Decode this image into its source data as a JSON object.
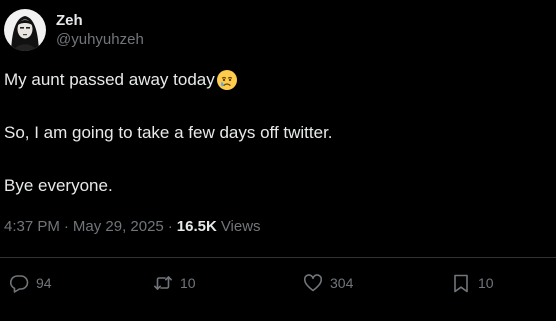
{
  "colors": {
    "background": "#000000",
    "text_primary": "#e7e9ea",
    "text_secondary": "#71767b",
    "divider": "#2f3336"
  },
  "author": {
    "display_name": "Zeh",
    "handle": "@yuhyuhzeh",
    "avatar_icon": "avatar-photo"
  },
  "tweet": {
    "lines": [
      "My aunt passed away today",
      "So, I am going to take a few days off twitter.",
      "Bye everyone."
    ],
    "emoji_icon": "crying-face-emoji"
  },
  "meta": {
    "time": "4:37 PM",
    "separator": "·",
    "date": "May 29, 2025",
    "views_count": "16.5K",
    "views_label": "Views"
  },
  "actions": {
    "reply": {
      "icon": "reply-icon",
      "count": "94"
    },
    "retweet": {
      "icon": "retweet-icon",
      "count": "10"
    },
    "like": {
      "icon": "heart-icon",
      "count": "304"
    },
    "bookmark": {
      "icon": "bookmark-icon",
      "count": "10"
    }
  }
}
